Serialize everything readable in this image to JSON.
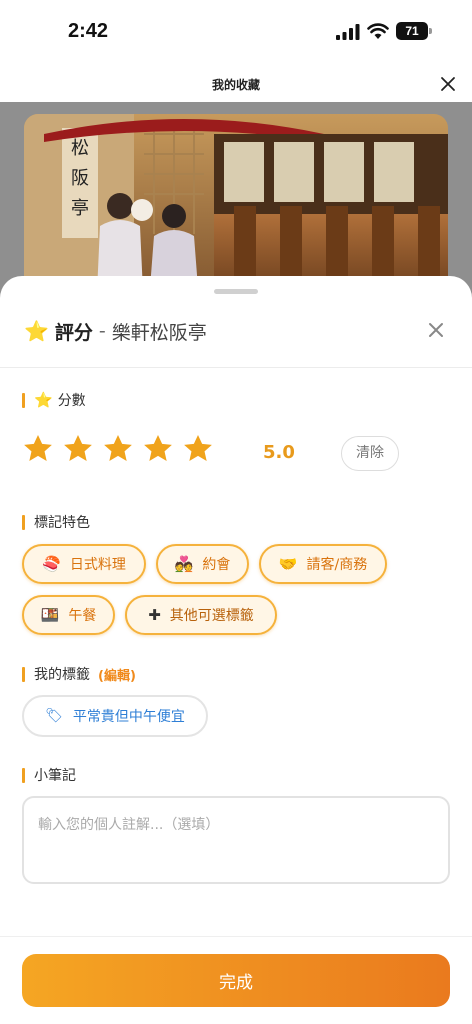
{
  "status_bar": {
    "time": "2:42",
    "battery": "71"
  },
  "header": {
    "title": "我的收藏"
  },
  "sheet": {
    "title": "評分",
    "separator": "-",
    "restaurant": "樂軒松阪亭"
  },
  "rating": {
    "label": "分數",
    "stars_filled": 5,
    "stars_total": 5,
    "score": "5.0",
    "clear_label": "清除"
  },
  "features": {
    "label": "標記特色",
    "chips": [
      {
        "icon": "🍣",
        "label": "日式料理"
      },
      {
        "icon": "💑",
        "label": "約會"
      },
      {
        "icon": "🤝",
        "label": "請客/商務"
      },
      {
        "icon": "🍱",
        "label": "午餐"
      },
      {
        "icon": "✚",
        "label": "其他可選標籤"
      }
    ]
  },
  "my_tags": {
    "label": "我的標籤",
    "edit_label": "(編輯)",
    "tags": [
      {
        "icon": "🏷",
        "label": "平常貴但中午便宜"
      }
    ]
  },
  "notes": {
    "label": "小筆記",
    "placeholder": "輸入您的個人註解...（選填）"
  },
  "done_label": "完成",
  "colors": {
    "accent": "#f0a020",
    "star": "#f4b51c",
    "tag_text": "#2f7fd6"
  }
}
